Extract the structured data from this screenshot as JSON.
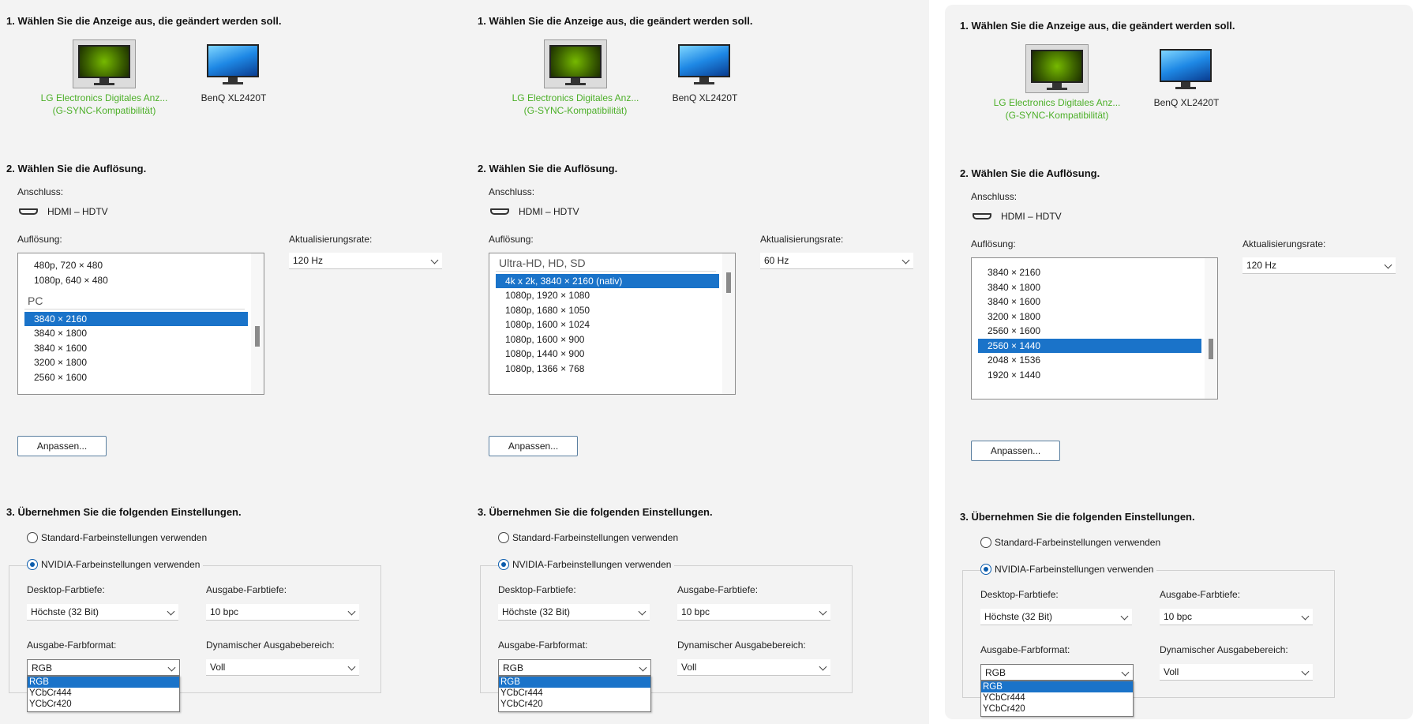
{
  "panels": [
    {
      "step1": "1. Wählen Sie die Anzeige aus, die geändert werden soll.",
      "monitors": [
        {
          "label1": "LG Electronics Digitales Anz...",
          "label2": "(G-SYNC-Kompatibilität)"
        },
        {
          "label1": "BenQ XL2420T",
          "label2": ""
        }
      ],
      "step2": "2. Wählen Sie die Auflösung.",
      "anschluss_label": "Anschluss:",
      "connection": "HDMI – HDTV",
      "aufloesung_label": "Auflösung:",
      "refresh_label": "Aktualisierungsrate:",
      "refresh_value": "120 Hz",
      "resolutions": [
        "480p, 720 × 480",
        "1080p, 640 × 480",
        "PC",
        "3840 × 2160",
        "3840 × 1800",
        "3840 × 1600",
        "3200 × 1800",
        "2560 × 1600"
      ],
      "adjust_button": "Anpassen...",
      "step3": "3. Übernehmen Sie die folgenden Einstellungen.",
      "radio_default": "Standard-Farbeinstellungen verwenden",
      "radio_nvidia": "NVIDIA-Farbeinstellungen verwenden",
      "desktop_depth_label": "Desktop-Farbtiefe:",
      "desktop_depth_value": "Höchste (32 Bit)",
      "output_depth_label": "Ausgabe-Farbtiefe:",
      "output_depth_value": "10 bpc",
      "output_format_label": "Ausgabe-Farbformat:",
      "output_format_value": "RGB",
      "dynamic_range_label": "Dynamischer Ausgabebereich:",
      "dynamic_range_value": "Voll",
      "format_options": [
        "RGB",
        "YCbCr444",
        "YCbCr420"
      ]
    },
    {
      "step1": "1. Wählen Sie die Anzeige aus, die geändert werden soll.",
      "monitors": [
        {
          "label1": "LG Electronics Digitales Anz...",
          "label2": "(G-SYNC-Kompatibilität)"
        },
        {
          "label1": "BenQ XL2420T",
          "label2": ""
        }
      ],
      "step2": "2. Wählen Sie die Auflösung.",
      "anschluss_label": "Anschluss:",
      "connection": "HDMI – HDTV",
      "aufloesung_label": "Auflösung:",
      "refresh_label": "Aktualisierungsrate:",
      "refresh_value": "60 Hz",
      "resolutions": [
        "Ultra-HD, HD, SD",
        "4k x 2k, 3840 × 2160 (nativ)",
        "1080p, 1920 × 1080",
        "1080p, 1680 × 1050",
        "1080p, 1600 × 1024",
        "1080p, 1600 × 900",
        "1080p, 1440 × 900",
        "1080p, 1366 × 768"
      ],
      "adjust_button": "Anpassen...",
      "step3": "3. Übernehmen Sie die folgenden Einstellungen.",
      "radio_default": "Standard-Farbeinstellungen verwenden",
      "radio_nvidia": "NVIDIA-Farbeinstellungen verwenden",
      "desktop_depth_label": "Desktop-Farbtiefe:",
      "desktop_depth_value": "Höchste (32 Bit)",
      "output_depth_label": "Ausgabe-Farbtiefe:",
      "output_depth_value": "10 bpc",
      "output_format_label": "Ausgabe-Farbformat:",
      "output_format_value": "RGB",
      "dynamic_range_label": "Dynamischer Ausgabebereich:",
      "dynamic_range_value": "Voll",
      "format_options": [
        "RGB",
        "YCbCr444",
        "YCbCr420"
      ]
    },
    {
      "step1": "1. Wählen Sie die Anzeige aus, die geändert werden soll.",
      "monitors": [
        {
          "label1": "LG Electronics Digitales Anz...",
          "label2": "(G-SYNC-Kompatibilität)"
        },
        {
          "label1": "BenQ XL2420T",
          "label2": ""
        }
      ],
      "step2": "2. Wählen Sie die Auflösung.",
      "anschluss_label": "Anschluss:",
      "connection": "HDMI – HDTV",
      "aufloesung_label": "Auflösung:",
      "refresh_label": "Aktualisierungsrate:",
      "refresh_value": "120 Hz",
      "resolutions": [
        "3840 × 2160",
        "3840 × 1800",
        "3840 × 1600",
        "3200 × 1800",
        "2560 × 1600",
        "2560 × 1440",
        "2048 × 1536",
        "1920 × 1440"
      ],
      "adjust_button": "Anpassen...",
      "step3": "3. Übernehmen Sie die folgenden Einstellungen.",
      "radio_default": "Standard-Farbeinstellungen verwenden",
      "radio_nvidia": "NVIDIA-Farbeinstellungen verwenden",
      "desktop_depth_label": "Desktop-Farbtiefe:",
      "desktop_depth_value": "Höchste (32 Bit)",
      "output_depth_label": "Ausgabe-Farbtiefe:",
      "output_depth_value": "10 bpc",
      "output_format_label": "Ausgabe-Farbformat:",
      "output_format_value": "RGB",
      "dynamic_range_label": "Dynamischer Ausgabebereich:",
      "dynamic_range_value": "Voll",
      "format_options": [
        "RGB",
        "YCbCr444",
        "YCbCr420"
      ]
    }
  ],
  "colors": {
    "accent": "#1a73c9",
    "selected_monitor_text": "#4caf28",
    "nvidia_green": "#76b900"
  }
}
